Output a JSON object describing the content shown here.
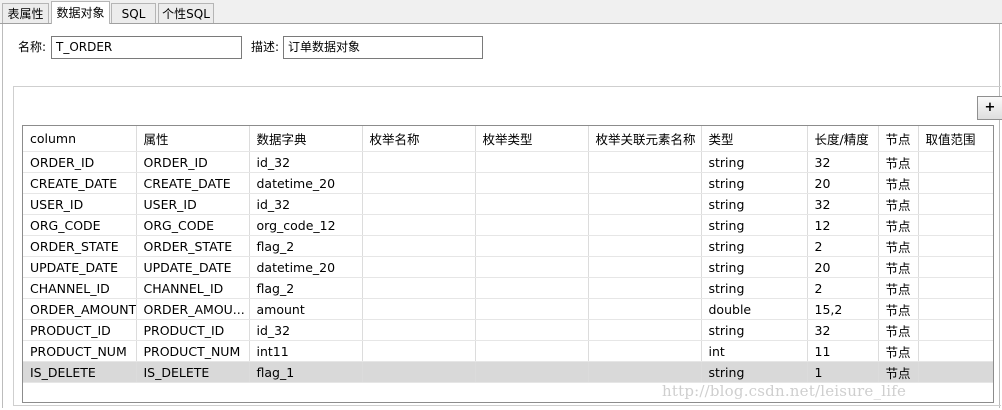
{
  "tabs": [
    {
      "label": "表属性"
    },
    {
      "label": "数据对象"
    },
    {
      "label": "SQL"
    },
    {
      "label": "个性SQL"
    }
  ],
  "form": {
    "name_label": "名称:",
    "name_value": "T_ORDER",
    "desc_label": "描述:",
    "desc_value": "订单数据对象"
  },
  "add_button": "+",
  "table": {
    "columns": [
      "column",
      "属性",
      "数据字典",
      "枚举名称",
      "枚举类型",
      "枚举关联元素名称",
      "类型",
      "长度/精度",
      "节点",
      "取值范围"
    ],
    "rows": [
      [
        "ORDER_ID",
        "ORDER_ID",
        "id_32",
        "",
        "",
        "",
        "string",
        "32",
        "节点",
        ""
      ],
      [
        "CREATE_DATE",
        "CREATE_DATE",
        "datetime_20",
        "",
        "",
        "",
        "string",
        "20",
        "节点",
        ""
      ],
      [
        "USER_ID",
        "USER_ID",
        "id_32",
        "",
        "",
        "",
        "string",
        "32",
        "节点",
        ""
      ],
      [
        "ORG_CODE",
        "ORG_CODE",
        "org_code_12",
        "",
        "",
        "",
        "string",
        "12",
        "节点",
        ""
      ],
      [
        "ORDER_STATE",
        "ORDER_STATE",
        "flag_2",
        "",
        "",
        "",
        "string",
        "2",
        "节点",
        ""
      ],
      [
        "UPDATE_DATE",
        "UPDATE_DATE",
        "datetime_20",
        "",
        "",
        "",
        "string",
        "20",
        "节点",
        ""
      ],
      [
        "CHANNEL_ID",
        "CHANNEL_ID",
        "flag_2",
        "",
        "",
        "",
        "string",
        "2",
        "节点",
        ""
      ],
      [
        "ORDER_AMOUNT",
        "ORDER_AMOU...",
        "amount",
        "",
        "",
        "",
        "double",
        "15,2",
        "节点",
        ""
      ],
      [
        "PRODUCT_ID",
        "PRODUCT_ID",
        "id_32",
        "",
        "",
        "",
        "string",
        "32",
        "节点",
        ""
      ],
      [
        "PRODUCT_NUM",
        "PRODUCT_NUM",
        "int11",
        "",
        "",
        "",
        "int",
        "11",
        "节点",
        ""
      ],
      [
        "IS_DELETE",
        "IS_DELETE",
        "flag_1",
        "",
        "",
        "",
        "string",
        "1",
        "节点",
        ""
      ]
    ],
    "selected_row": 10
  },
  "watermark": "http://blog.csdn.net/leisure_life"
}
